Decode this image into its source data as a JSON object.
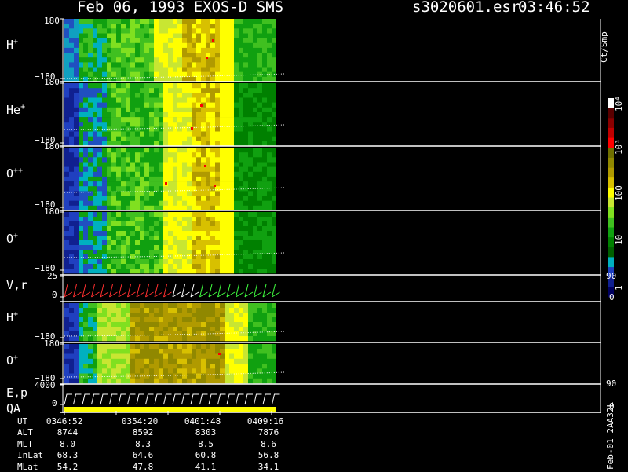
{
  "header": {
    "title": "Feb 06, 1993   EXOS-D SMS",
    "file": "s3020601.esr",
    "time": "03:46:52"
  },
  "colorbar": {
    "unit": "Ct/Smp",
    "ticks": [
      "10⁴",
      "10³",
      "100",
      "10",
      "1"
    ],
    "colors": [
      "#ffffff",
      "#5a0000",
      "#8b0000",
      "#c00000",
      "#ff0000",
      "#707000",
      "#908800",
      "#b09a00",
      "#d8c000",
      "#ffff00",
      "#c8e632",
      "#80e020",
      "#40c020",
      "#10a010",
      "#008000",
      "#006000",
      "#00b0c0",
      "#2040c0",
      "#102090",
      "#000060"
    ]
  },
  "panels": [
    {
      "id": "h-plus-1",
      "label": "H",
      "sup": "+",
      "ymax": "180",
      "ymin": "−180"
    },
    {
      "id": "he-plus",
      "label": "He",
      "sup": "+",
      "ymax": "180",
      "ymin": "−180"
    },
    {
      "id": "o-plus-plus",
      "label": "O",
      "sup": "++",
      "ymax": "180",
      "ymin": "−180"
    },
    {
      "id": "o-plus-1",
      "label": "O",
      "sup": "+",
      "ymax": "180",
      "ymin": "−180"
    },
    {
      "id": "v-r",
      "label": "V,r",
      "ymax": "25",
      "ymin": "0",
      "right_max": "90",
      "right_min": "0"
    },
    {
      "id": "h-plus-2",
      "label": "H",
      "sup": "+",
      "ymax": "",
      "ymin": "−180"
    },
    {
      "id": "o-plus-2",
      "label": "O",
      "sup": "+",
      "ymax": "180",
      "ymin": "−180"
    },
    {
      "id": "e-p",
      "label": "E,p",
      "label2": "QA",
      "ymax": "4000",
      "ymin": "0",
      "right_max": "90",
      "right_min": "0"
    }
  ],
  "footer": {
    "rows": [
      {
        "name": "UT",
        "values": [
          "0346:52",
          "0354:20",
          "0401:48",
          "0409:16"
        ]
      },
      {
        "name": "ALT",
        "values": [
          "8744",
          "8592",
          "8303",
          "7876"
        ]
      },
      {
        "name": "MLT",
        "values": [
          "8.0",
          "8.3",
          "8.5",
          "8.6"
        ]
      },
      {
        "name": "InLat",
        "values": [
          "68.3",
          "64.6",
          "60.8",
          "56.8"
        ]
      },
      {
        "name": "MLat",
        "values": [
          "54.2",
          "47.8",
          "41.1",
          "34.1"
        ]
      }
    ],
    "side_label": "Feb-01 2AA32L"
  },
  "chart_data": {
    "type": "heatmap",
    "x": [
      "0346:52",
      "0354:20",
      "0401:48",
      "0409:16"
    ],
    "series": [
      {
        "name": "H+",
        "ylim": [
          -180,
          180
        ]
      },
      {
        "name": "He+",
        "ylim": [
          -180,
          180
        ]
      },
      {
        "name": "O++",
        "ylim": [
          -180,
          180
        ]
      },
      {
        "name": "O+",
        "ylim": [
          -180,
          180
        ]
      },
      {
        "name": "V,r",
        "ylim": [
          0,
          25
        ]
      },
      {
        "name": "H+",
        "ylim": [
          -180,
          180
        ]
      },
      {
        "name": "O+",
        "ylim": [
          -180,
          180
        ]
      },
      {
        "name": "E,p",
        "ylim": [
          0,
          4000
        ]
      }
    ],
    "colorbar_range": [
      1,
      10000
    ],
    "colorbar_scale": "log"
  }
}
